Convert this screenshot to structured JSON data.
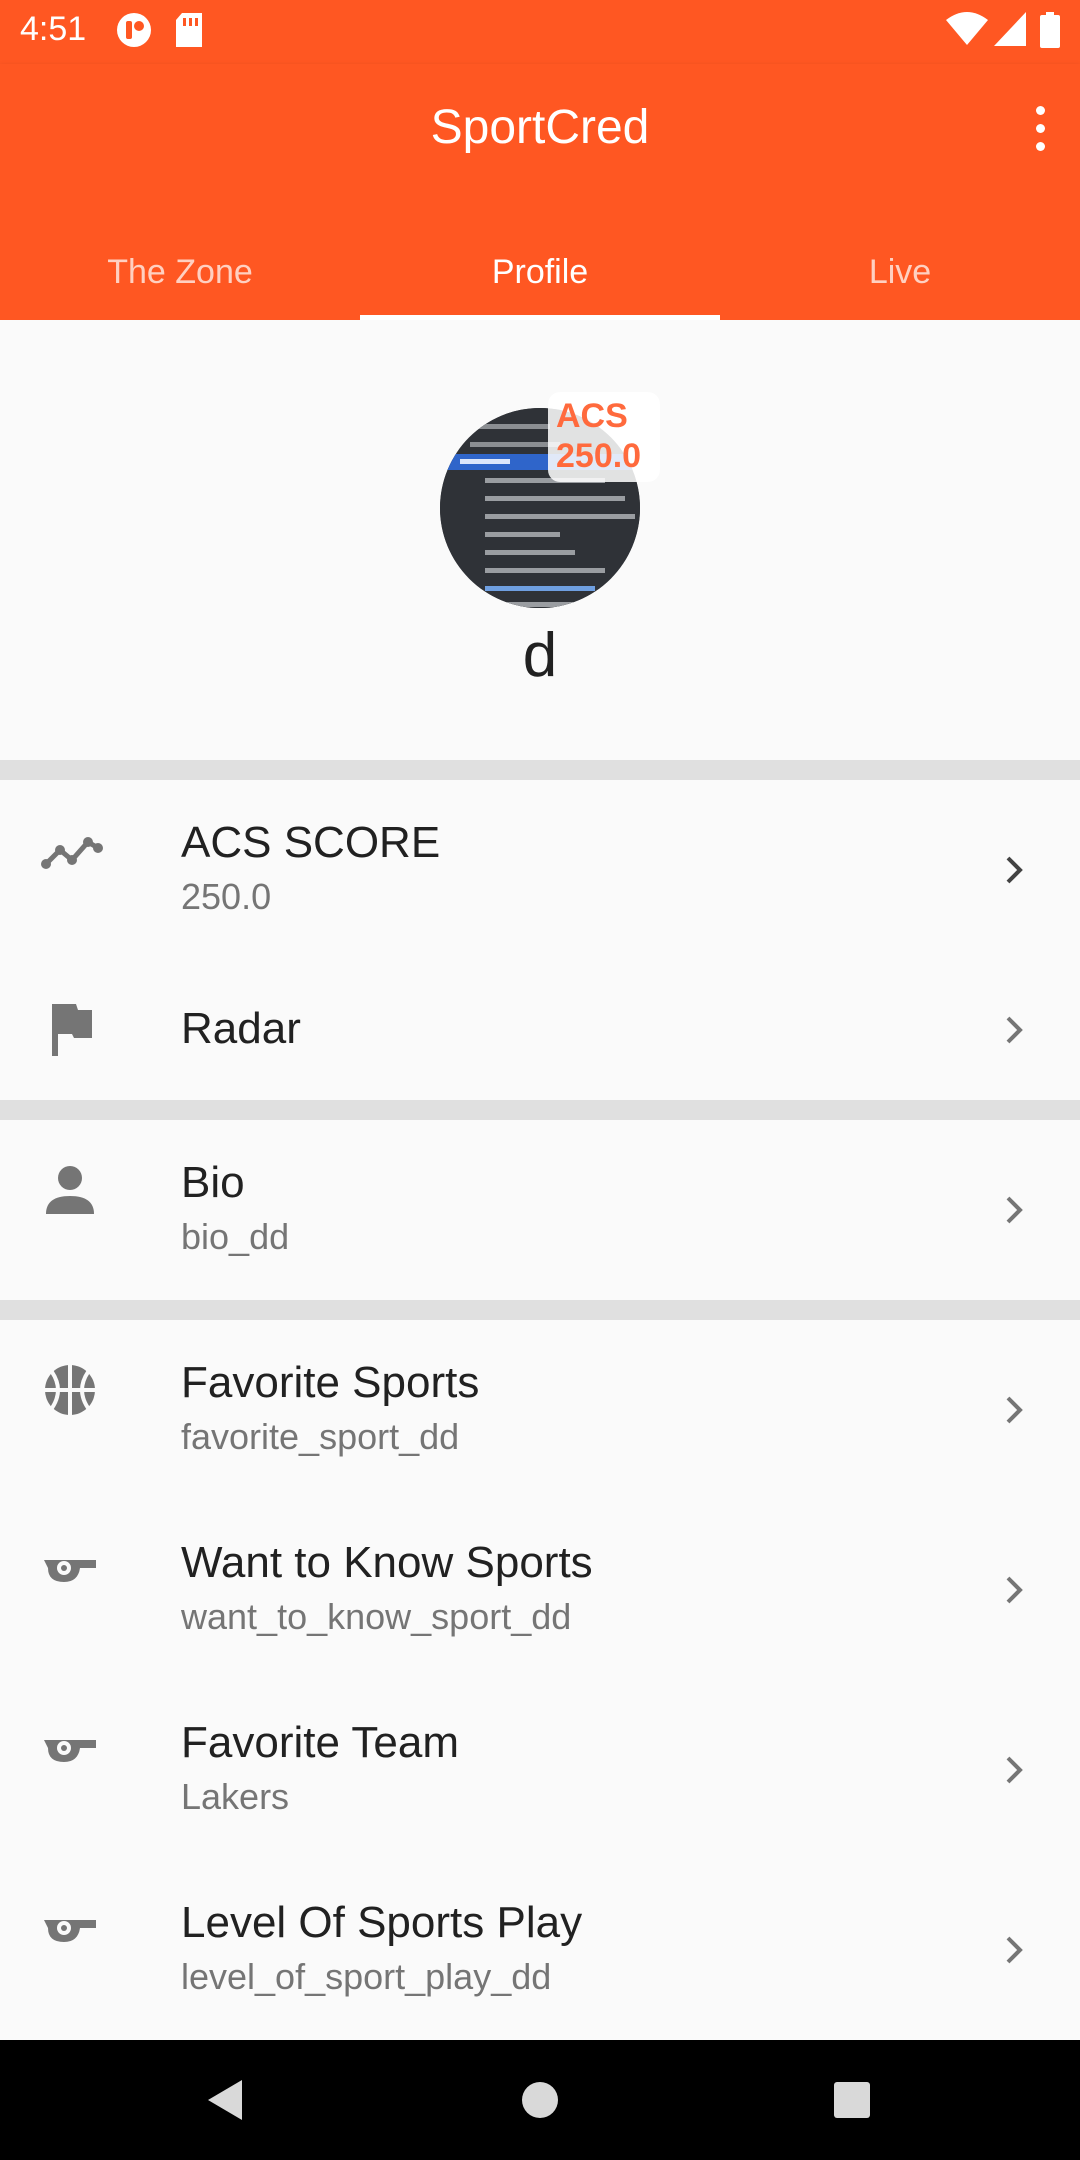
{
  "status_bar": {
    "time": "4:51",
    "icons": [
      "app-notification-icon",
      "sd-card-icon",
      "wifi-icon",
      "signal-icon",
      "battery-icon"
    ]
  },
  "app_bar": {
    "title": "SportCred",
    "menu_icon": "more-vert-icon"
  },
  "tabs": [
    {
      "label": "The Zone",
      "active": false
    },
    {
      "label": "Profile",
      "active": true
    },
    {
      "label": "Live",
      "active": false
    }
  ],
  "profile": {
    "username": "d",
    "acs_badge": {
      "label": "ACS",
      "value": "250.0"
    }
  },
  "list": {
    "acs_score": {
      "title": "ACS SCORE",
      "subtitle": "250.0",
      "icon": "trending-icon"
    },
    "radar": {
      "title": "Radar",
      "icon": "flag-icon"
    },
    "bio": {
      "title": "Bio",
      "subtitle": "bio_dd",
      "icon": "person-icon"
    },
    "favorite_sports": {
      "title": "Favorite Sports",
      "subtitle": "favorite_sport_dd",
      "icon": "basketball-icon"
    },
    "want_to_know": {
      "title": "Want to Know Sports",
      "subtitle": "want_to_know_sport_dd",
      "icon": "whistle-icon"
    },
    "favorite_team": {
      "title": "Favorite Team",
      "subtitle": "Lakers",
      "icon": "whistle-icon"
    },
    "level_of_play": {
      "title": "Level Of Sports Play",
      "subtitle": "level_of_sport_play_dd",
      "icon": "whistle-icon"
    }
  },
  "nav_bar": {
    "buttons": [
      "back-icon",
      "home-icon",
      "recents-icon"
    ]
  },
  "colors": {
    "primary": "#ff5722",
    "divider": "#e0e0e0",
    "icon_gray": "#757575",
    "badge_text": "#ff6a3d"
  }
}
